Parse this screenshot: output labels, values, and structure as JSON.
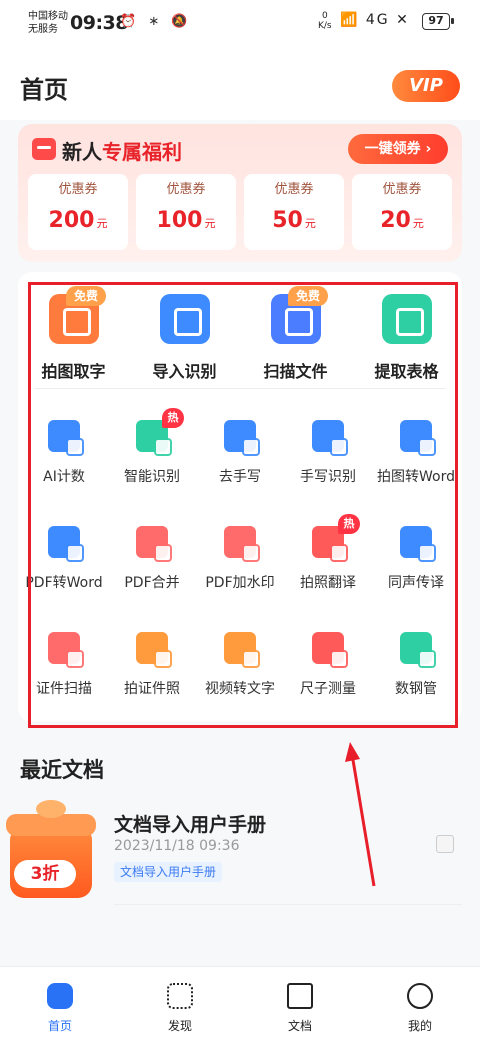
{
  "status_bar": {
    "carrier": [
      "中国移动",
      "无服务"
    ],
    "time": "09:38",
    "icons": "⏰ ∗ 🔕",
    "net_speed": [
      "0",
      "K/s"
    ],
    "signal": "📶 4G ✕",
    "battery": "97"
  },
  "header": {
    "title": "首页",
    "vip": "VIP"
  },
  "promo": {
    "title_a": "新人",
    "title_b": "专属福利",
    "claim": "一键领券 ›",
    "coupons": [
      {
        "label": "优惠券",
        "amount": "200",
        "unit": "元"
      },
      {
        "label": "优惠券",
        "amount": "100",
        "unit": "元"
      },
      {
        "label": "优惠券",
        "amount": "50",
        "unit": "元"
      },
      {
        "label": "优惠券",
        "amount": "20",
        "unit": "元"
      }
    ]
  },
  "tools_big": [
    {
      "label": "拍图取字",
      "badge": "免费",
      "color": "#ff7a3d"
    },
    {
      "label": "导入识别",
      "badge": "",
      "color": "#3d8bff"
    },
    {
      "label": "扫描文件",
      "badge": "免费",
      "color": "#4a7dff"
    },
    {
      "label": "提取表格",
      "badge": "",
      "color": "#2ecfa3"
    }
  ],
  "tools_small": [
    {
      "label": "AI计数",
      "color": "#3d8bff",
      "hot": ""
    },
    {
      "label": "智能识别",
      "color": "#2ecfa3",
      "hot": "热"
    },
    {
      "label": "去手写",
      "color": "#3d8bff",
      "hot": ""
    },
    {
      "label": "手写识别",
      "color": "#3d8bff",
      "hot": ""
    },
    {
      "label": "拍图转Word",
      "color": "#3d8bff",
      "hot": ""
    },
    {
      "label": "PDF转Word",
      "color": "#3d8bff",
      "hot": ""
    },
    {
      "label": "PDF合并",
      "color": "#ff6b6b",
      "hot": ""
    },
    {
      "label": "PDF加水印",
      "color": "#ff6b6b",
      "hot": ""
    },
    {
      "label": "拍照翻译",
      "color": "#ff5a5a",
      "hot": "热"
    },
    {
      "label": "同声传译",
      "color": "#3d8bff",
      "hot": ""
    },
    {
      "label": "证件扫描",
      "color": "#ff6b6b",
      "hot": ""
    },
    {
      "label": "拍证件照",
      "color": "#ff9a3d",
      "hot": ""
    },
    {
      "label": "视频转文字",
      "color": "#ff9a3d",
      "hot": ""
    },
    {
      "label": "尺子测量",
      "color": "#ff5a5a",
      "hot": ""
    },
    {
      "label": "数钢管",
      "color": "#2ecfa3",
      "hot": ""
    }
  ],
  "recent": {
    "title": "最近文档",
    "doc": {
      "name": "文档导入用户手册",
      "date": "2023/11/18 09:36",
      "tag": "文档导入用户手册",
      "discount": "3折"
    }
  },
  "tabs": [
    {
      "label": "首页",
      "icon": "home-icon",
      "active": true
    },
    {
      "label": "发现",
      "icon": "discover-icon",
      "active": false
    },
    {
      "label": "文档",
      "icon": "folder-icon",
      "active": false
    },
    {
      "label": "我的",
      "icon": "profile-icon",
      "active": false
    }
  ]
}
